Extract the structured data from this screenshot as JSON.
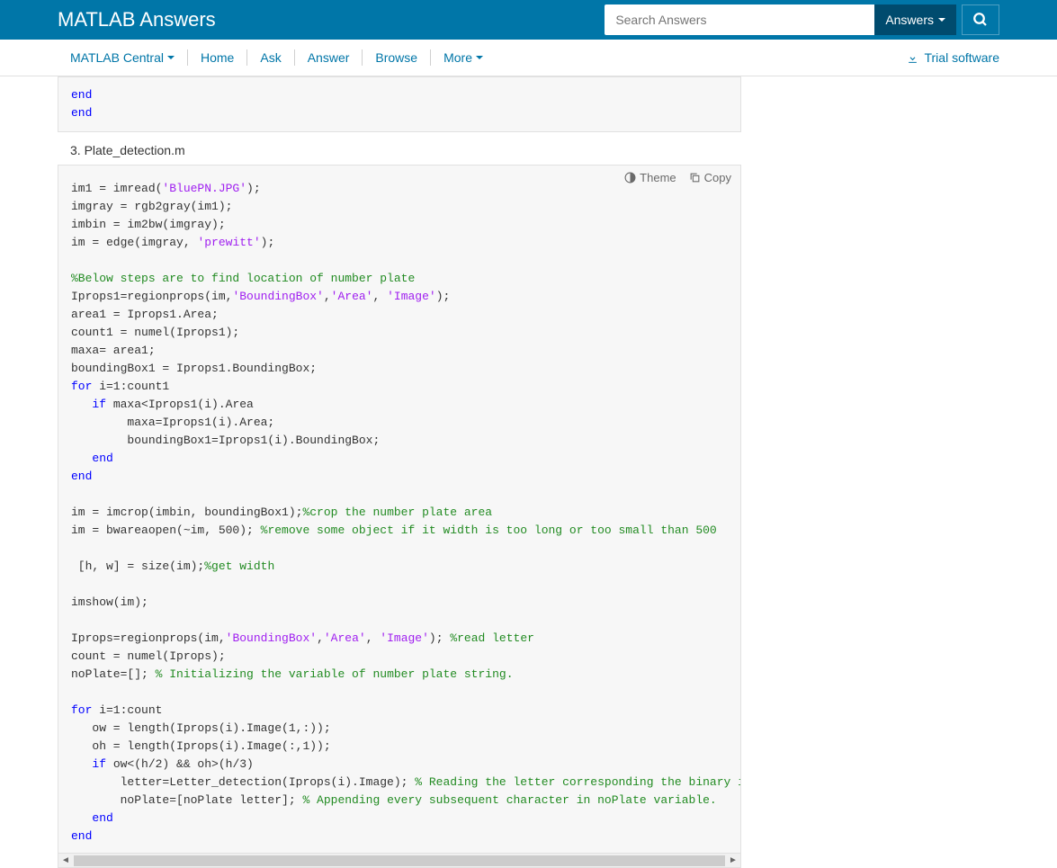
{
  "header": {
    "brand": "MATLAB Answers",
    "search_placeholder": "Search Answers",
    "answers_dropdown": "Answers"
  },
  "nav": {
    "items": [
      "MATLAB Central",
      "Home",
      "Ask",
      "Answer",
      "Browse",
      "More"
    ],
    "trial": "Trial software"
  },
  "codeTop": {
    "line1": "end",
    "line2": "end"
  },
  "sectionLabel": "3. Plate_detection.m",
  "toolbar": {
    "theme": "Theme",
    "copy": "Copy"
  },
  "code": {
    "l1a": "im1 = imread(",
    "l1b": "'BluePN.JPG'",
    "l1c": ");",
    "l2": "imgray = rgb2gray(im1);",
    "l3": "imbin = im2bw(imgray);",
    "l4a": "im = edge(imgray, ",
    "l4b": "'prewitt'",
    "l4c": ");",
    "l6": "%Below steps are to find location of number plate",
    "l7a": "Iprops1=regionprops(im,",
    "l7b": "'BoundingBox'",
    "l7c": ",",
    "l7d": "'Area'",
    "l7e": ", ",
    "l7f": "'Image'",
    "l7g": ");",
    "l8": "area1 = Iprops1.Area;",
    "l9": "count1 = numel(Iprops1);",
    "l10": "maxa= area1;",
    "l11": "boundingBox1 = Iprops1.BoundingBox;",
    "l12a": "for",
    "l12b": " i=1:count1",
    "l13a": "   ",
    "l13b": "if",
    "l13c": " maxa<Iprops1(i).Area",
    "l14": "        maxa=Iprops1(i).Area;",
    "l15": "        boundingBox1=Iprops1(i).BoundingBox;",
    "l16a": "   ",
    "l16b": "end",
    "l17": "end",
    "l19a": "im = imcrop(imbin, boundingBox1);",
    "l19b": "%crop the number plate area",
    "l20a": "im = bwareaopen(~im, 500); ",
    "l20b": "%remove some object if it width is too long or too small than 500",
    "l22a": " [h, w] = size(im);",
    "l22b": "%get width",
    "l24": "imshow(im);",
    "l26a": "Iprops=regionprops(im,",
    "l26b": "'BoundingBox'",
    "l26c": ",",
    "l26d": "'Area'",
    "l26e": ", ",
    "l26f": "'Image'",
    "l26g": "); ",
    "l26h": "%read letter",
    "l27": "count = numel(Iprops);",
    "l28a": "noPlate=[]; ",
    "l28b": "% Initializing the variable of number plate string.",
    "l30a": "for",
    "l30b": " i=1:count",
    "l31": "   ow = length(Iprops(i).Image(1,:));",
    "l32": "   oh = length(Iprops(i).Image(:,1));",
    "l33a": "   ",
    "l33b": "if",
    "l33c": " ow<(h/2) && oh>(h/3)",
    "l34a": "       letter=Letter_detection(Iprops(i).Image); ",
    "l34b": "% Reading the letter corresponding the binary image 'N'",
    "l35a": "       noPlate=[noPlate letter]; ",
    "l35b": "% Appending every subsequent character in noPlate variable.",
    "l36a": "   ",
    "l36b": "end",
    "l37": "end"
  }
}
